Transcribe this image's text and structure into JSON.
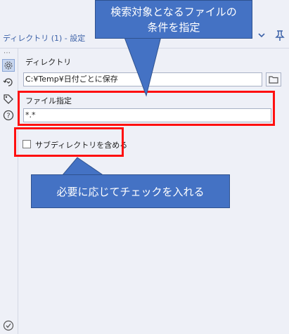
{
  "panel": {
    "title": "ディレクトリ (1) - 設定"
  },
  "fields": {
    "directory_label": "ディレクトリ",
    "directory_value": "C:¥Temp¥日付ごとに保存",
    "file_spec_label": "ファイル指定",
    "file_spec_value": "*.*",
    "include_subdirs_label": "サブディレクトリを含める",
    "include_subdirs_checked": false
  },
  "callouts": {
    "top": [
      "検索対象となるファイルの",
      "条件を指定"
    ],
    "bottom": "必要に応じてチェックを入れる"
  },
  "icons": {
    "sidebar": [
      "gear-icon",
      "refresh-icon",
      "tag-icon",
      "help-icon"
    ],
    "bottom": "check-circle-icon",
    "header": [
      "chevron-down-icon",
      "pin-icon"
    ],
    "browse": "folder-icon"
  },
  "colors": {
    "accent": "#3d62a8",
    "callout": "#4472c4",
    "highlight": "#ff1010"
  }
}
